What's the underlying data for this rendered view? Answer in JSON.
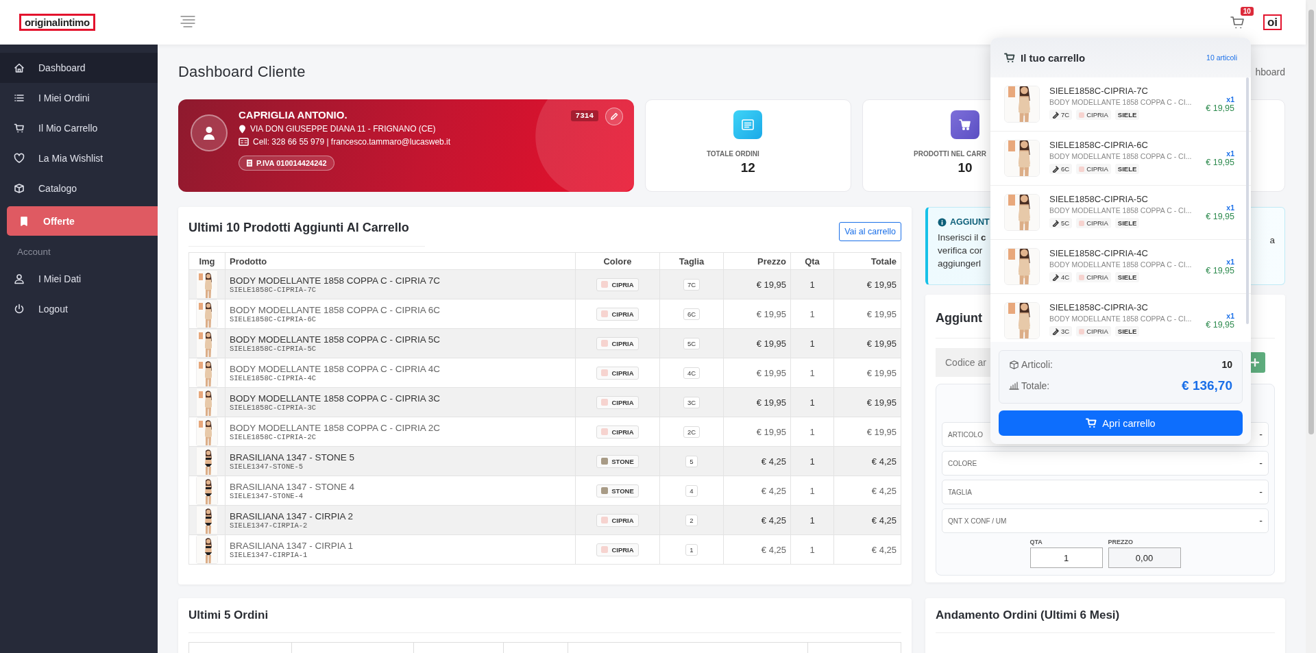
{
  "header": {
    "logo": "originalintimo",
    "cart_badge": "10",
    "user_logo": "oi"
  },
  "sidebar": {
    "items": [
      {
        "kind": "link",
        "label": "Dashboard",
        "selected": true
      },
      {
        "kind": "link",
        "label": "I Miei Ordini",
        "selected": false
      },
      {
        "kind": "link",
        "label": "Il Mio Carrello",
        "selected": false
      },
      {
        "kind": "link",
        "label": "La Mia Wishlist",
        "selected": false
      },
      {
        "kind": "link",
        "label": "Catalogo",
        "selected": false
      },
      {
        "kind": "promo",
        "label": "Offerte",
        "selected": false
      },
      {
        "kind": "section",
        "label": "Account"
      },
      {
        "kind": "link",
        "label": "I Miei Dati",
        "selected": false
      },
      {
        "kind": "link",
        "label": "Logout",
        "selected": false
      }
    ]
  },
  "page": {
    "title": "Dashboard Cliente",
    "breadcrumb": "hboard"
  },
  "profile": {
    "name": "CAPRIGLIA ANTONIO.",
    "address": "VIA DON GIUSEPPE DIANA 11 - FRIGNANO (CE)",
    "contact": "Cell: 328 66 55 979 | francesco.tammaro@lucasweb.it",
    "vat": "P.IVA 010014424242",
    "code": "7314"
  },
  "stats": [
    {
      "kind": "orders",
      "label": "TOTALE ORDINI",
      "value": "12"
    },
    {
      "kind": "cart",
      "label": "PRODOTTI NEL CARR",
      "value": "10"
    }
  ],
  "recent_products": {
    "title": "Ultimi 10 Prodotti Aggiunti Al Carrello",
    "button": "Vai al carrello",
    "columns": [
      "Img",
      "Prodotto",
      "Colore",
      "Taglia",
      "Prezzo",
      "Qta",
      "Totale"
    ],
    "rows": [
      {
        "name": "BODY MODELLANTE 1858 COPPA C - CIPRIA 7C",
        "code": "SIELE1858C-CIPRIA-7C",
        "color_name": "CIPRIA",
        "color": "#f6d3cf",
        "size": "7C",
        "price": "€ 19,95",
        "qty": "1",
        "total": "€ 19,95"
      },
      {
        "name": "BODY MODELLANTE 1858 COPPA C - CIPRIA 6C",
        "code": "SIELE1858C-CIPRIA-6C",
        "color_name": "CIPRIA",
        "color": "#f6d3cf",
        "size": "6C",
        "price": "€ 19,95",
        "qty": "1",
        "total": "€ 19,95"
      },
      {
        "name": "BODY MODELLANTE 1858 COPPA C - CIPRIA 5C",
        "code": "SIELE1858C-CIPRIA-5C",
        "color_name": "CIPRIA",
        "color": "#f6d3cf",
        "size": "5C",
        "price": "€ 19,95",
        "qty": "1",
        "total": "€ 19,95"
      },
      {
        "name": "BODY MODELLANTE 1858 COPPA C - CIPRIA 4C",
        "code": "SIELE1858C-CIPRIA-4C",
        "color_name": "CIPRIA",
        "color": "#f6d3cf",
        "size": "4C",
        "price": "€ 19,95",
        "qty": "1",
        "total": "€ 19,95"
      },
      {
        "name": "BODY MODELLANTE 1858 COPPA C - CIPRIA 3C",
        "code": "SIELE1858C-CIPRIA-3C",
        "color_name": "CIPRIA",
        "color": "#f6d3cf",
        "size": "3C",
        "price": "€ 19,95",
        "qty": "1",
        "total": "€ 19,95"
      },
      {
        "name": "BODY MODELLANTE 1858 COPPA C - CIPRIA 2C",
        "code": "SIELE1858C-CIPRIA-2C",
        "color_name": "CIPRIA",
        "color": "#f6d3cf",
        "size": "2C",
        "price": "€ 19,95",
        "qty": "1",
        "total": "€ 19,95"
      },
      {
        "name": "BRASILIANA 1347 - STONE 5",
        "code": "SIELE1347-STONE-5",
        "color_name": "STONE",
        "color": "#a89b86",
        "size": "5",
        "price": "€ 4,25",
        "qty": "1",
        "total": "€ 4,25"
      },
      {
        "name": "BRASILIANA 1347 - STONE 4",
        "code": "SIELE1347-STONE-4",
        "color_name": "STONE",
        "color": "#a89b86",
        "size": "4",
        "price": "€ 4,25",
        "qty": "1",
        "total": "€ 4,25"
      },
      {
        "name": "BRASILIANA 1347 - CIRPIA 2",
        "code": "SIELE1347-CIRPIA-2",
        "color_name": "CIPRIA",
        "color": "#f6d3cf",
        "size": "2",
        "price": "€ 4,25",
        "qty": "1",
        "total": "€ 4,25"
      },
      {
        "name": "BRASILIANA 1347 - CIRPIA 1",
        "code": "SIELE1347-CIRPIA-1",
        "color_name": "CIPRIA",
        "color": "#f6d3cf",
        "size": "1",
        "price": "€ 4,25",
        "qty": "1",
        "total": "€ 4,25"
      }
    ]
  },
  "info_alert": {
    "title": "AGGIUNT",
    "lines": [
      "Inserisci il **c**",
      "verifica cor",
      "aggiungerl"
    ],
    "tail": "a"
  },
  "quick_add": {
    "title": "Aggiunt",
    "code_placeholder": "Codice ar",
    "fields": [
      {
        "label": "ARTICOLO",
        "value": "-"
      },
      {
        "label": "COLORE",
        "value": "-"
      },
      {
        "label": "TAGLIA",
        "value": "-"
      },
      {
        "label": "QNT X CONF / UM",
        "value": "-"
      }
    ],
    "qty_label": "QTA",
    "qty": "1",
    "price_label": "PREZZO",
    "price": "0,00"
  },
  "recent_orders": {
    "title": "Ultimi 5 Ordini"
  },
  "orders_chart": {
    "title": "Andamento Ordini (Ultimi 6 Mesi)"
  },
  "cart_dropdown": {
    "title": "Il tuo carrello",
    "count": "10 articoli",
    "items": [
      {
        "code": "SIELE1858C-CIPRIA-7C",
        "name": "BODY MODELLANTE 1858 COPPA C - CI...",
        "size": "7C",
        "color_name": "CIPRIA",
        "color": "#f6d3cf",
        "brand": "SIELE",
        "qty": "x1",
        "price": "€ 19,95"
      },
      {
        "code": "SIELE1858C-CIPRIA-6C",
        "name": "BODY MODELLANTE 1858 COPPA C - CI...",
        "size": "6C",
        "color_name": "CIPRIA",
        "color": "#f6d3cf",
        "brand": "SIELE",
        "qty": "x1",
        "price": "€ 19,95"
      },
      {
        "code": "SIELE1858C-CIPRIA-5C",
        "name": "BODY MODELLANTE 1858 COPPA C - CI...",
        "size": "5C",
        "color_name": "CIPRIA",
        "color": "#f6d3cf",
        "brand": "SIELE",
        "qty": "x1",
        "price": "€ 19,95"
      },
      {
        "code": "SIELE1858C-CIPRIA-4C",
        "name": "BODY MODELLANTE 1858 COPPA C - CI...",
        "size": "4C",
        "color_name": "CIPRIA",
        "color": "#f6d3cf",
        "brand": "SIELE",
        "qty": "x1",
        "price": "€ 19,95"
      },
      {
        "code": "SIELE1858C-CIPRIA-3C",
        "name": "BODY MODELLANTE 1858 COPPA C - CI...",
        "size": "3C",
        "color_name": "CIPRIA",
        "color": "#f6d3cf",
        "brand": "SIELE",
        "qty": "x1",
        "price": "€ 19,95"
      }
    ],
    "summary": {
      "items_label": "Articoli:",
      "items": "10",
      "total_label": "Totale:",
      "total": "€ 136,70"
    },
    "button": "Apri carrello"
  }
}
